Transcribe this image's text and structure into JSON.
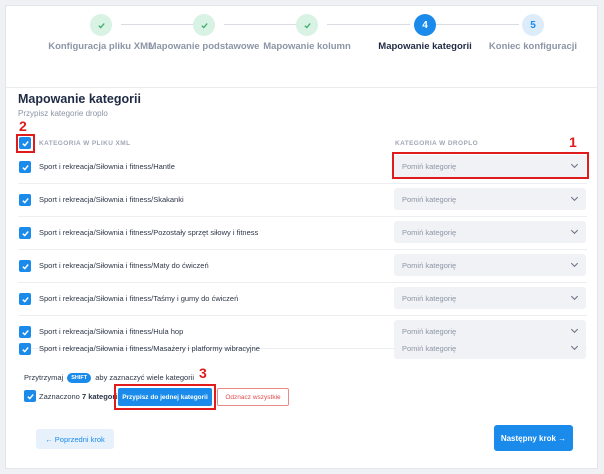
{
  "steps": [
    {
      "label": "Konfiguracja pliku XML",
      "state": "done",
      "icon": "check-icon"
    },
    {
      "label": "Mapowanie podstawowe",
      "state": "done",
      "icon": "check-icon"
    },
    {
      "label": "Mapowanie kolumn",
      "state": "done",
      "icon": "check-icon"
    },
    {
      "number": "4",
      "label": "Mapowanie kategorii",
      "state": "active"
    },
    {
      "number": "5",
      "label": "Koniec konfiguracji",
      "state": "todo"
    }
  ],
  "section": {
    "title": "Mapowanie kategorii",
    "subtitle": "Przypisz kategorie droplo"
  },
  "columns": {
    "xml": "KATEGORIA W PLIKU XML",
    "droplo": "KATEGORIA W DROPLO"
  },
  "rows": [
    {
      "path": "Sport i rekreacja/Siłownia i fitness/Hantle",
      "select": "Pomiń kategorię"
    },
    {
      "path": "Sport i rekreacja/Siłownia i fitness/Skakanki",
      "select": "Pomiń kategorię"
    },
    {
      "path": "Sport i rekreacja/Siłownia i fitness/Pozostały sprzęt siłowy i fitness",
      "select": "Pomiń kategorię"
    },
    {
      "path": "Sport i rekreacja/Siłownia i fitness/Maty do ćwiczeń",
      "select": "Pomiń kategorię"
    },
    {
      "path": "Sport i rekreacja/Siłownia i fitness/Taśmy i gumy do ćwiczeń",
      "select": "Pomiń kategorię"
    },
    {
      "path": "Sport i rekreacja/Siłownia i fitness/Hula hop",
      "select": "Pomiń kategorię"
    },
    {
      "path": "Sport i rekreacja/Siłownia i fitness/Masażery i platformy wibracyjne",
      "select": "Pomiń kategorię"
    }
  ],
  "footer": {
    "hint_before": "Przytrzymaj",
    "hint_key": "SHIFT",
    "hint_after": "aby zaznaczyć wiele kategorii",
    "selected_prefix": "Zaznaczono",
    "selected_count": "7 kategorii",
    "assign_button": "Przypisz do jednej kategorii",
    "unmark_button": "Odznacz wszystkie"
  },
  "nav": {
    "prev": "← Poprzedni krok",
    "next": "Następny krok →"
  },
  "annotations": [
    "1",
    "2",
    "3"
  ],
  "colors": {
    "accent": "#1a8bea",
    "annotation": "#e01b1b",
    "done": "#3ea76a"
  }
}
